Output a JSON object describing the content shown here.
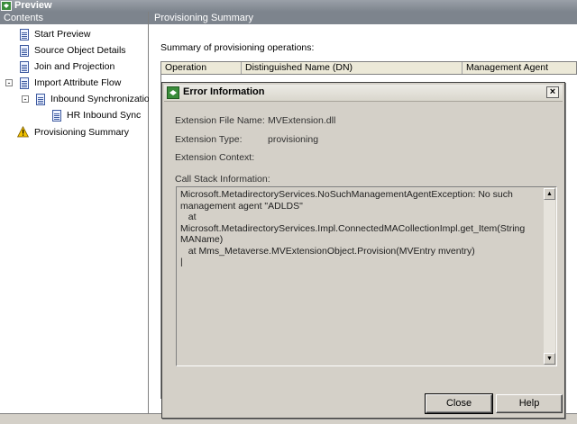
{
  "window": {
    "title": "Preview"
  },
  "left_pane": {
    "header": "Contents",
    "items": [
      {
        "label": "Start Preview",
        "icon": "document-icon"
      },
      {
        "label": "Source Object Details",
        "icon": "document-icon"
      },
      {
        "label": "Join and Projection",
        "icon": "document-icon"
      },
      {
        "label": "Import Attribute Flow",
        "icon": "document-icon",
        "expander": "-"
      },
      {
        "label": "Inbound Synchronization",
        "icon": "document-icon",
        "expander": "-"
      },
      {
        "label": "HR Inbound Sync",
        "icon": "document-icon"
      },
      {
        "label": "Provisioning Summary",
        "icon": "warning-icon"
      }
    ]
  },
  "right_pane": {
    "header": "Provisioning Summary",
    "summary_label": "Summary of provisioning operations:",
    "columns": [
      "Operation",
      "Distinguished Name (DN)",
      "Management Agent"
    ]
  },
  "dialog": {
    "title": "Error Information",
    "close_glyph": "×",
    "fields": [
      {
        "label": "Extension File Name:",
        "value": "MVExtension.dll"
      },
      {
        "label": "Extension Type:",
        "value": "provisioning"
      },
      {
        "label": "Extension Context:",
        "value": ""
      }
    ],
    "call_stack_label": "Call Stack Information:",
    "call_stack": "Microsoft.MetadirectoryServices.NoSuchManagementAgentException: No such management agent \"ADLDS\"\n   at Microsoft.MetadirectoryServices.Impl.ConnectedMACollectionImpl.get_Item(String MAName)\n   at Mms_Metaverse.MVExtensionObject.Provision(MVEntry mventry)\n|",
    "buttons": {
      "close": "Close",
      "help": "Help"
    }
  },
  "colors": {
    "header_gray": "#7d848d",
    "dialog_bg": "#d4d0c8",
    "warning_yellow": "#f2c200"
  }
}
